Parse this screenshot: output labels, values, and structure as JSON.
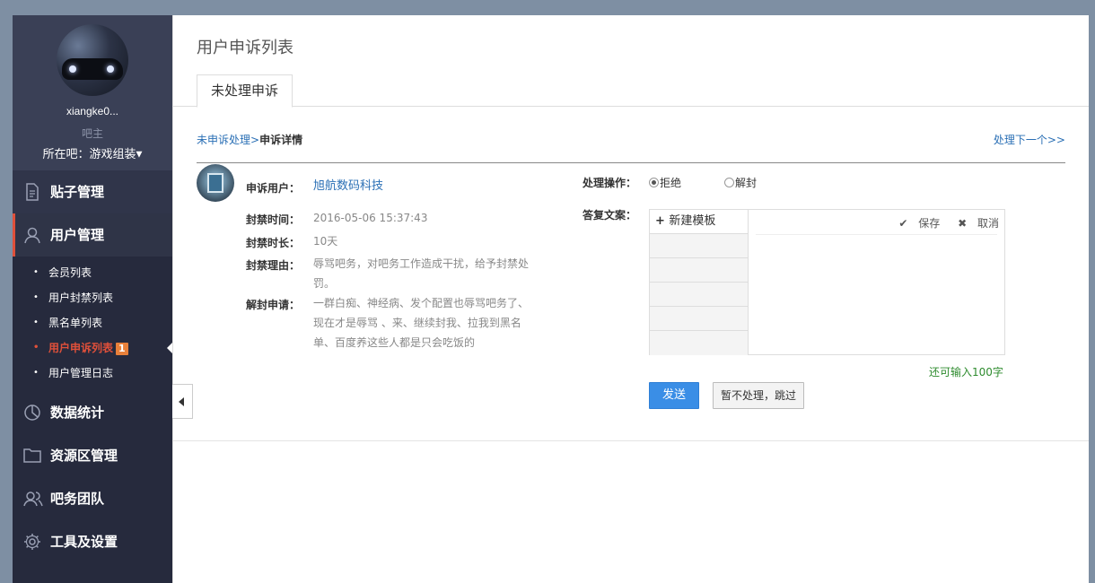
{
  "sidebar": {
    "username": "xiangke0...",
    "role": "吧主",
    "bar_label": "所在吧：游戏组装",
    "nav": [
      {
        "label": "贴子管理",
        "icon": "document-icon"
      },
      {
        "label": "用户管理",
        "icon": "user-icon"
      },
      {
        "label": "数据统计",
        "icon": "pie-chart-icon"
      },
      {
        "label": "资源区管理",
        "icon": "folder-icon"
      },
      {
        "label": "吧务团队",
        "icon": "team-icon"
      },
      {
        "label": "工具及设置",
        "icon": "gear-icon"
      }
    ],
    "user_sub": [
      {
        "label": "会员列表"
      },
      {
        "label": "用户封禁列表"
      },
      {
        "label": "黑名单列表"
      },
      {
        "label": "用户申诉列表",
        "badge": "1"
      },
      {
        "label": "用户管理日志"
      }
    ]
  },
  "main": {
    "title": "用户申诉列表",
    "tab": "未处理申诉",
    "breadcrumb": {
      "link": "未申诉处理",
      "sep": ">",
      "current": "申诉详情"
    },
    "next_link": "处理下一个>>",
    "appeal": {
      "user_label": "申诉用户：",
      "user_value": "旭航数码科技",
      "time_label": "封禁时间：",
      "time_value": "2016-05-06 15:37:43",
      "duration_label": "封禁时长：",
      "duration_value": "10天",
      "reason_label": "封禁理由：",
      "reason_value": "辱骂吧务，对吧务工作造成干扰，给予封禁处罚。",
      "request_label": "解封申请：",
      "request_value": "一群白痴、神经病、发个配置也辱骂吧务了、现在才是辱骂 、来、继续封我、拉我到黑名单、百度养这些人都是只会吃饭的"
    },
    "action": {
      "label": "处理操作：",
      "options": [
        {
          "label": "拒绝",
          "checked": true
        },
        {
          "label": "解封",
          "checked": false
        }
      ],
      "reply_label": "答复文案：",
      "new_template": "新建模板",
      "save": "保存",
      "cancel": "取消",
      "remaining": "还可输入100字",
      "send": "发送",
      "skip": "暂不处理，跳过"
    }
  }
}
